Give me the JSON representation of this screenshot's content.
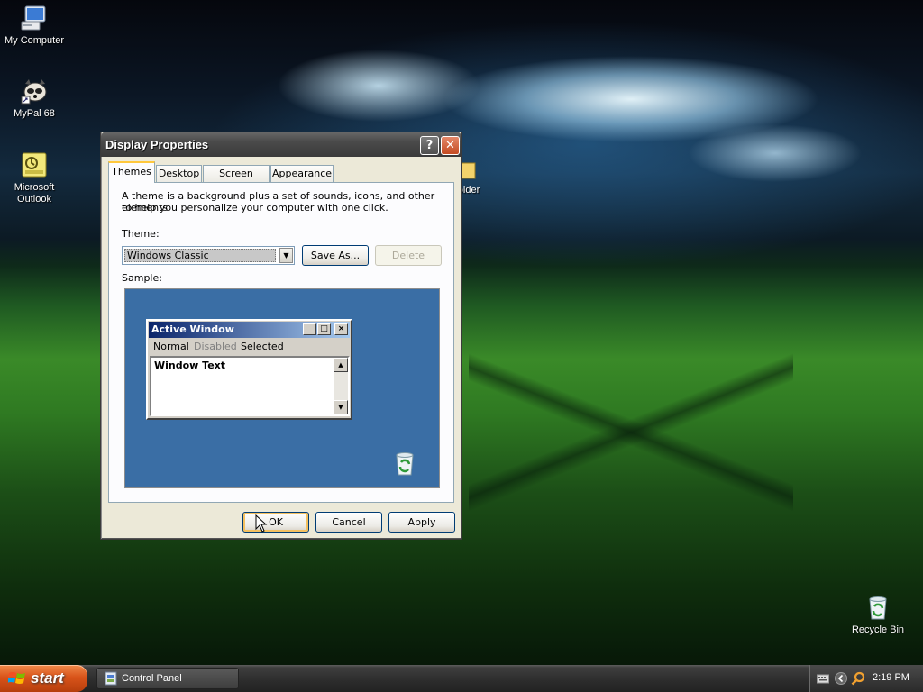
{
  "desktop": {
    "icons": [
      {
        "label": "My Computer",
        "icon": "my-computer-icon"
      },
      {
        "label": "MyPal 68",
        "icon": "mypal-browser-icon"
      },
      {
        "label": "Microsoft Outlook",
        "icon": "outlook-icon"
      },
      {
        "label": "older",
        "icon": "folder-icon"
      },
      {
        "label": "Recycle Bin",
        "icon": "recycle-bin-icon"
      }
    ]
  },
  "dialog": {
    "title": "Display Properties",
    "help_glyph": "?",
    "close_glyph": "✕",
    "tabs": [
      {
        "label": "Themes",
        "active": true
      },
      {
        "label": "Desktop",
        "active": false
      },
      {
        "label": "Screen Saver",
        "active": false
      },
      {
        "label": "Appearance",
        "active": false
      }
    ],
    "description_line1": "A theme is a background plus a set of sounds, icons, and other elements",
    "description_line2": "to help you personalize your computer with one click.",
    "theme_label": "Theme:",
    "theme_value": "Windows Classic",
    "save_as_label": "Save As...",
    "delete_label": "Delete",
    "sample_label": "Sample:",
    "sample": {
      "window_title": "Active Window",
      "menu": [
        "Normal",
        "Disabled",
        "Selected"
      ],
      "window_text": "Window Text",
      "background_color": "#3a6ea5"
    },
    "ok_label": "OK",
    "cancel_label": "Cancel",
    "apply_label": "Apply"
  },
  "taskbar": {
    "start_label": "start",
    "tasks": [
      {
        "label": "Control Panel",
        "icon": "control-panel-icon"
      }
    ],
    "clock": "2:19 PM",
    "tray_icons": [
      "keyboard-icon",
      "chevron-left-icon",
      "search-icon"
    ]
  },
  "colors": {
    "accent_start": "#d9541a",
    "title_bar": "#4a4a4a",
    "close_button": "#c44a21",
    "tab_highlight": "#ffc83c"
  }
}
